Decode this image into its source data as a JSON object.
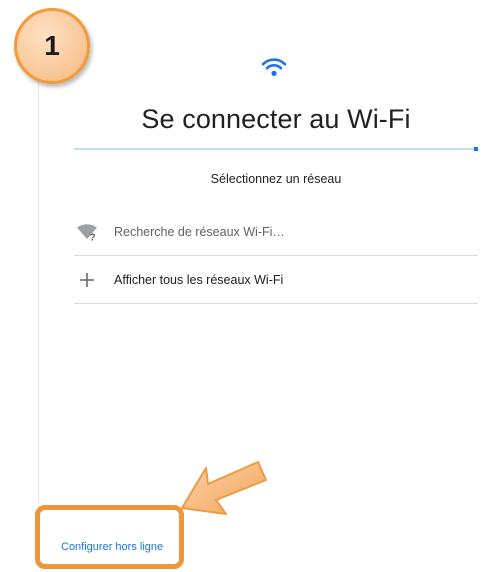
{
  "step": {
    "number": "1"
  },
  "header": {
    "icon": "wifi-icon",
    "title": "Se connecter au Wi-Fi"
  },
  "progress": {
    "fraction": 1.0,
    "track_color": "#c6dafc",
    "fill_color": "#1a73e8"
  },
  "network_list": {
    "subtitle": "Sélectionnez un réseau",
    "items": [
      {
        "icon": "wifi-searching-icon",
        "label": "Recherche de réseaux Wi-Fi…"
      },
      {
        "icon": "plus-icon",
        "label": "Afficher tous les réseaux Wi-Fi"
      }
    ]
  },
  "footer": {
    "offline_link": "Configurer hors ligne"
  },
  "annotation": {
    "highlight_color": "#f0963a",
    "arrow_icon": "arrow-pointer-icon"
  }
}
